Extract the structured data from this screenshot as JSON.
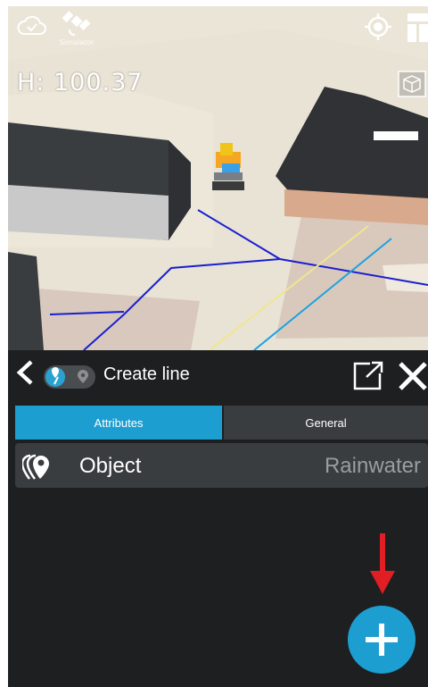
{
  "map": {
    "height_readout": "H: 100.37",
    "satellite_label": "Simulator",
    "icons": [
      "cloud-check-icon",
      "satellite-icon",
      "locate-icon",
      "layout-icon",
      "cube-view-icon",
      "excavator-icon"
    ],
    "line_colors": {
      "sewer": "#1a1fd0",
      "rain": "#19a7e0",
      "other": "#e8e08a"
    }
  },
  "panel": {
    "title": "Create line",
    "tabs": [
      {
        "label": "Attributes",
        "active": true
      },
      {
        "label": "General",
        "active": false
      }
    ],
    "object_row": {
      "label": "Object",
      "value": "Rainwater"
    },
    "accent_color": "#1d9ed1",
    "fab_label": "+"
  }
}
